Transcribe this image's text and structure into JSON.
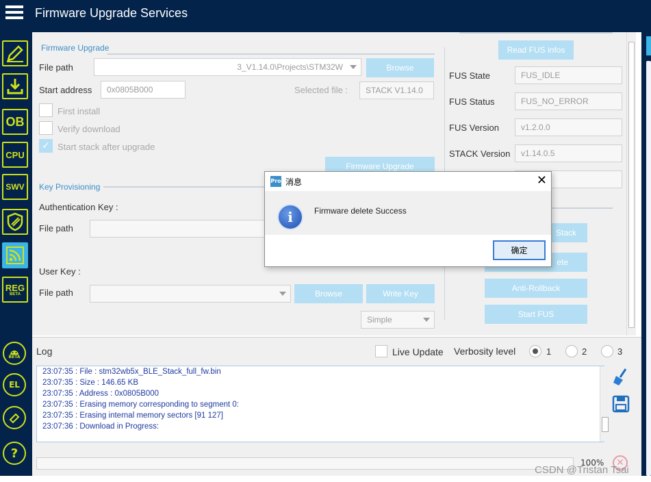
{
  "app": {
    "title": "Firmware Upgrade Services"
  },
  "colors": {
    "navy": "#03234b",
    "lime": "#cfe21b",
    "accent": "#3cb4e6",
    "disabled_button": "#b3def3",
    "section_title": "#3c8ec9",
    "log_text": "#1f3ba0"
  },
  "sidebar": {
    "items": [
      {
        "icon": "pencil-icon"
      },
      {
        "icon": "download-icon"
      },
      {
        "label": "OB"
      },
      {
        "label": "CPU"
      },
      {
        "label": "SWV"
      },
      {
        "icon": "shield-icon"
      },
      {
        "icon": "wireless-icon",
        "active": true
      },
      {
        "label": "REG",
        "badge": "BETA"
      }
    ],
    "bottom": [
      {
        "icon": "beta-robot-icon",
        "badge": "BETA"
      },
      {
        "label": "EL"
      },
      {
        "icon": "eraser-icon"
      },
      {
        "label": "?"
      }
    ]
  },
  "firmware_upgrade": {
    "title": "Firmware Upgrade",
    "file_path_label": "File path",
    "file_path_value": "3_V1.14.0\\Projects\\STM32W",
    "browse_label": "Browse",
    "start_address_label": "Start address",
    "start_address_value": "0x0805B000",
    "selected_file_label": "Selected file :",
    "selected_file_value": "STACK V1.14.0",
    "first_install_label": "First install",
    "verify_download_label": "Verify download",
    "start_stack_label": "Start stack after upgrade",
    "start_stack_checked": true,
    "upgrade_button": "Firmware Upgrade"
  },
  "key_provisioning": {
    "title": "Key Provisioning",
    "auth_key_label": "Authentication Key :",
    "file_path_label": "File path",
    "user_key_label": "User Key :",
    "file_path_label_2": "File path",
    "browse_label": "Browse",
    "write_key_label": "Write Key",
    "key_type_value": "Simple"
  },
  "fus_panel": {
    "read_button": "Read FUS infos",
    "fus_state_label": "FUS State",
    "fus_state_value": "FUS_IDLE",
    "fus_status_label": "FUS Status",
    "fus_status_value": "FUS_NO_ERROR",
    "fus_version_label": "FUS Version",
    "fus_version_value": "v1.2.0.0",
    "stack_version_label": "STACK Version",
    "stack_version_value": "v1.14.0.5",
    "stack_button_partial": "Stack",
    "delete_button_partial": "ete",
    "anti_rollback_button": "Anti-Rollback",
    "start_fus_button": "Start FUS"
  },
  "dialog": {
    "title": "消息",
    "message": "Firmware delete Success",
    "ok_label": "确定",
    "icon": "info-icon",
    "close": "✕"
  },
  "log": {
    "title": "Log",
    "live_update_label": "Live Update",
    "verbosity_label": "Verbosity level",
    "verbosity_options": [
      "1",
      "2",
      "3"
    ],
    "verbosity_selected": "1",
    "lines": [
      "23:07:35 :   File          : stm32wb5x_BLE_Stack_full_fw.bin",
      "23:07:35 :   Size          : 146.65 KB",
      "23:07:35 :   Address       : 0x0805B000",
      "23:07:35 : Erasing memory corresponding to segment 0:",
      "23:07:35 : Erasing internal memory sectors [91 127]",
      "23:07:36 : Download in Progress:"
    ],
    "progress_percent": "100%",
    "progress_value": 0
  },
  "watermark": "CSDN @Tristan Tsai"
}
